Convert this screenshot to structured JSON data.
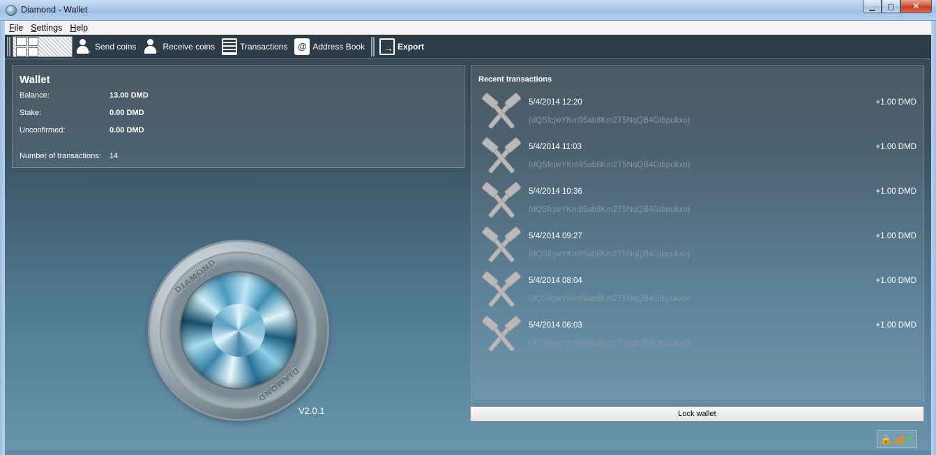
{
  "window": {
    "title": "Diamond - Wallet"
  },
  "menu": {
    "items": [
      {
        "label": "File",
        "accel": "F",
        "rest": "ile"
      },
      {
        "label": "Settings",
        "accel": "S",
        "rest": "ettings"
      },
      {
        "label": "Help",
        "accel": "H",
        "rest": "elp"
      }
    ]
  },
  "toolbar": {
    "send": "Send coins",
    "receive": "Receive coins",
    "transactions": "Transactions",
    "address_book": "Address Book",
    "export": "Export"
  },
  "wallet": {
    "title": "Wallet",
    "balance_label": "Balance:",
    "balance_value": "13.00 DMD",
    "stake_label": "Stake:",
    "stake_value": "0.00 DMD",
    "unconfirmed_label": "Unconfirmed:",
    "unconfirmed_value": "0.00 DMD",
    "num_tx_label": "Number of transactions:",
    "num_tx_value": "14"
  },
  "coin": {
    "text_top": "DIAMOND",
    "text_bottom": "DIAMOND"
  },
  "version": "V2.0.1",
  "recent": {
    "title": "Recent transactions",
    "items": [
      {
        "date": "5/4/2014 12:20",
        "amount": "+1.00 DMD",
        "address": "(dQSfcjwYKm95ab8Km2T5NqQB4Gtbpukxo)"
      },
      {
        "date": "5/4/2014 11:03",
        "amount": "+1.00 DMD",
        "address": "(dQSfcjwYKm95ab8Km2T5NqQB4Gtbpukxo)"
      },
      {
        "date": "5/4/2014 10:36",
        "amount": "+1.00 DMD",
        "address": "(dQSfcjwYKm95ab8Km2T5NqQB4Gtbpukxo)"
      },
      {
        "date": "5/4/2014 09:27",
        "amount": "+1.00 DMD",
        "address": "(dQSfcjwYKm95ab8Km2T5NqQB4Gtbpukxo)"
      },
      {
        "date": "5/4/2014 08:04",
        "amount": "+1.00 DMD",
        "address": "(dQSfcjwYKm95ab8Km2T5NqQB4Gtbpukxo)"
      },
      {
        "date": "5/4/2014 06:03",
        "amount": "+1.00 DMD",
        "address": "(dQSfcjwYKm95ab8Km2T5NqQB4Gtbpukxo)"
      }
    ]
  },
  "lock_button": "Lock wallet",
  "icons": {
    "tx_row": "mining-hammers-icon",
    "status": [
      "lock-icon",
      "connection-bars-icon",
      "sync-check-icon"
    ]
  }
}
